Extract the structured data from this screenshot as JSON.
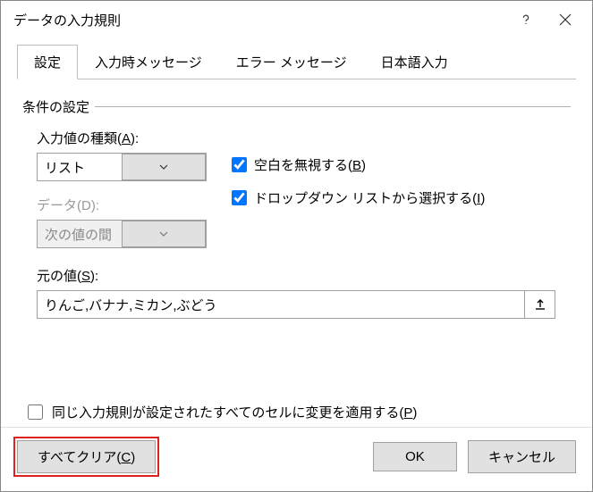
{
  "window": {
    "title": "データの入力規則"
  },
  "tabs": {
    "t0": "設定",
    "t1": "入力時メッセージ",
    "t2": "エラー メッセージ",
    "t3": "日本語入力"
  },
  "fieldset": {
    "title": "条件の設定"
  },
  "allow": {
    "label_pre": "入力値の種類(",
    "key": "A",
    "label_post": "):",
    "value": "リスト"
  },
  "data_dd": {
    "label_pre": "データ(",
    "key": "D",
    "label_post": "):",
    "value": "次の値の間"
  },
  "ignoreBlank": {
    "checked": true,
    "pre": "空白を無視する(",
    "key": "B",
    "post": ")"
  },
  "dropdown": {
    "checked": true,
    "pre": "ドロップダウン リストから選択する(",
    "key": "I",
    "post": ")"
  },
  "source": {
    "label_pre": "元の値(",
    "key": "S",
    "label_post": "):",
    "value": "りんご,バナナ,ミカン,ぶどう"
  },
  "applyAll": {
    "checked": false,
    "pre": "同じ入力規則が設定されたすべてのセルに変更を適用する(",
    "key": "P",
    "post": ")"
  },
  "buttons": {
    "clear_pre": "すべてクリア(",
    "clear_key": "C",
    "clear_post": ")",
    "ok": "OK",
    "cancel": "キャンセル"
  }
}
